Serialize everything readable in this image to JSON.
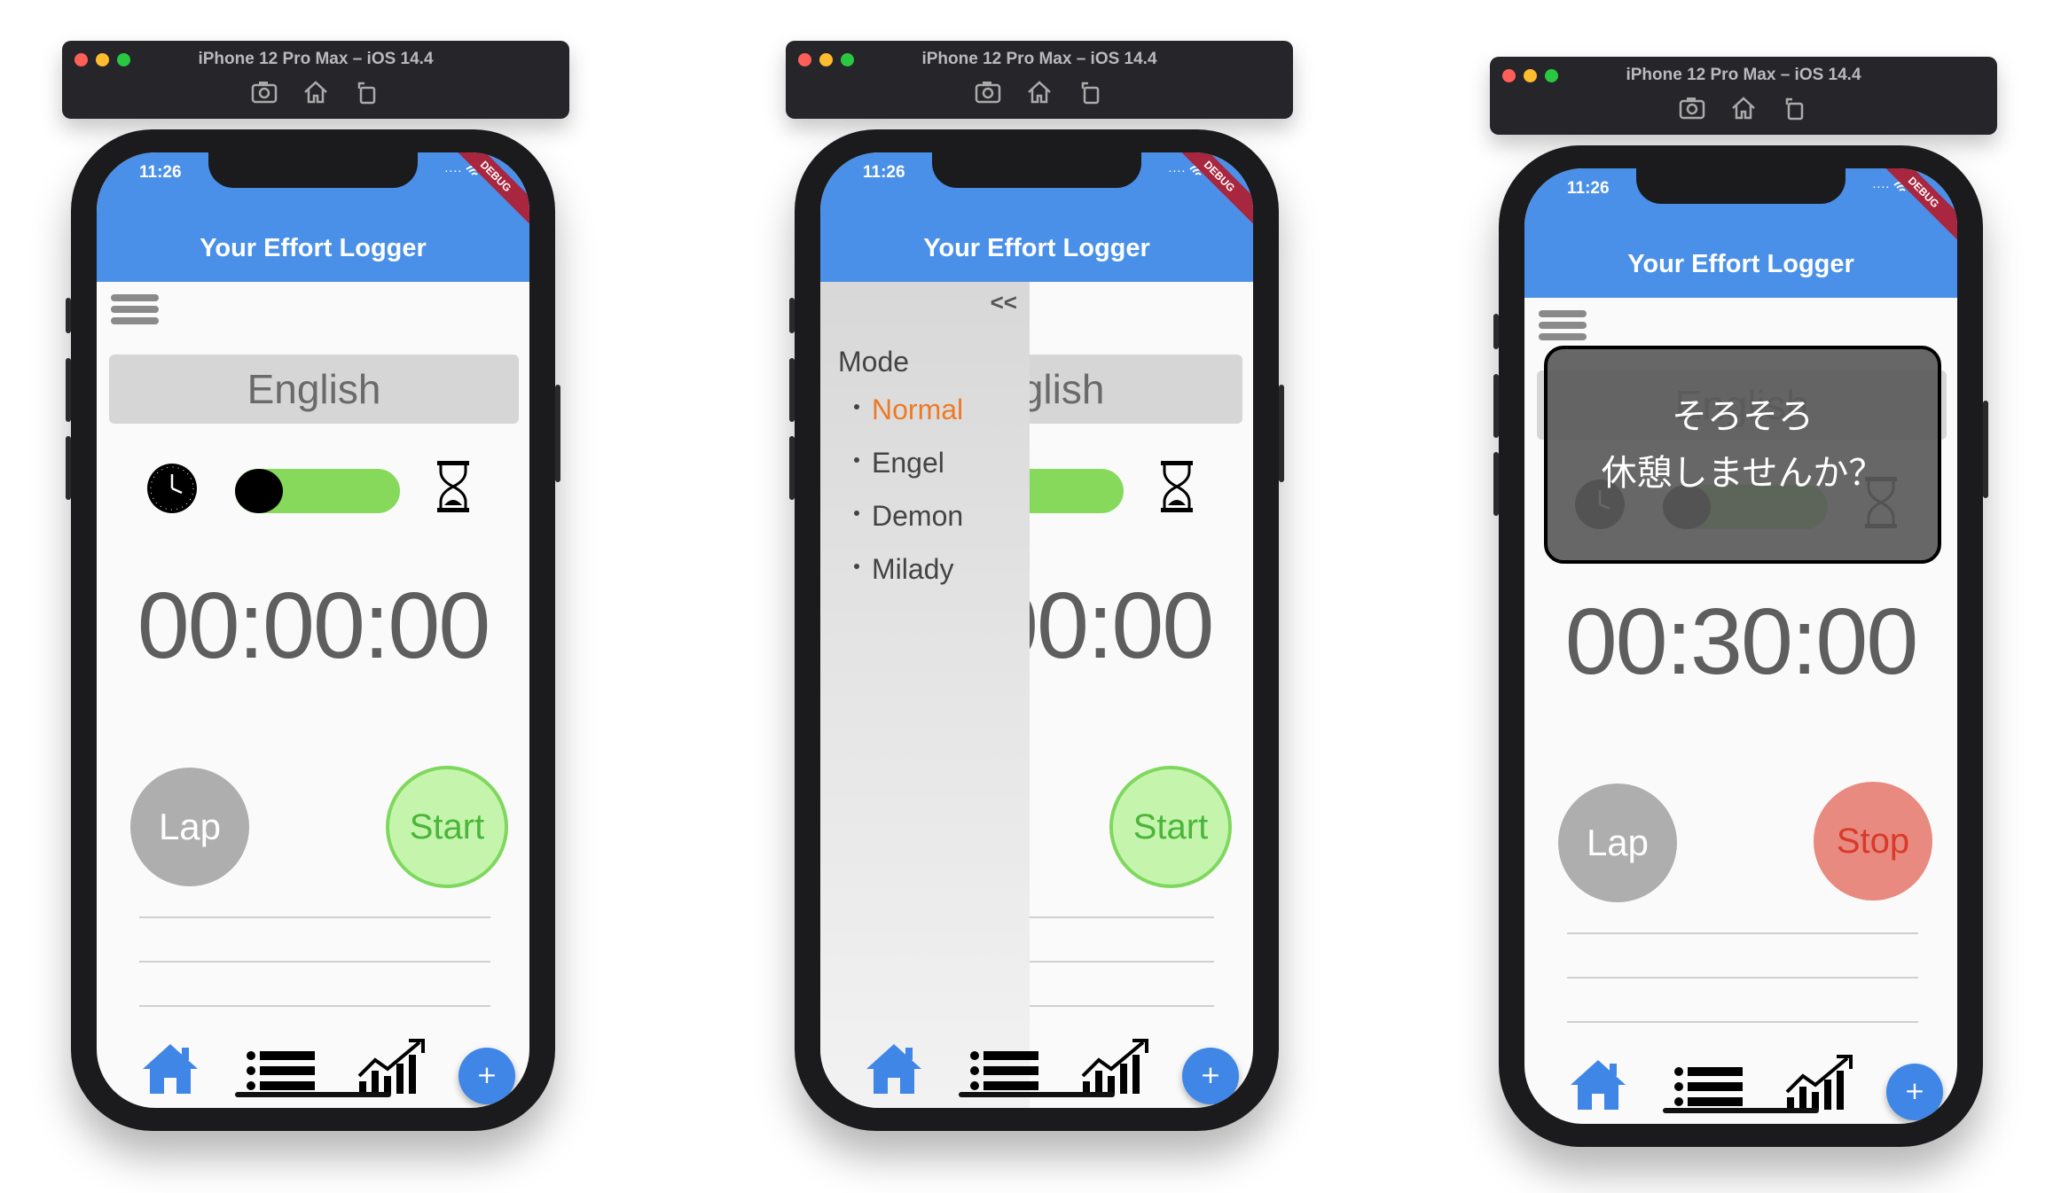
{
  "simulator": {
    "title": "iPhone 12 Pro Max – iOS 14.4"
  },
  "status_bar": {
    "time": "11:26",
    "debug": "DEBUG"
  },
  "app": {
    "title": "Your Effort Logger",
    "language": "English",
    "lap_label": "Lap",
    "start_label": "Start",
    "stop_label": "Stop"
  },
  "screens": [
    {
      "timer": "00:00:00",
      "toggle_on": true
    },
    {
      "timer": "00:00:00"
    },
    {
      "timer": "00:30:00",
      "overlay_line1": "そろそろ",
      "overlay_line2": "休憩しませんか？"
    }
  ],
  "drawer": {
    "close_label": "<<",
    "mode_label": "Mode",
    "items": [
      "Normal",
      "Engel",
      "Demon",
      "Milady"
    ],
    "selected": "Normal"
  },
  "fab_label": "+",
  "colors": {
    "appbar": "#4a90e8",
    "toggle_on": "#86d95a",
    "start_fill": "#c5f5ad",
    "stop_fill": "#e88a7f",
    "selected_mode": "#ee7a26",
    "tab_active": "#3f86e6"
  },
  "icons": [
    "camera-icon",
    "home-icon",
    "rotate-icon",
    "clock-icon",
    "hourglass-icon",
    "home-tab-icon",
    "list-tab-icon",
    "chart-tab-icon",
    "menu-icon"
  ]
}
